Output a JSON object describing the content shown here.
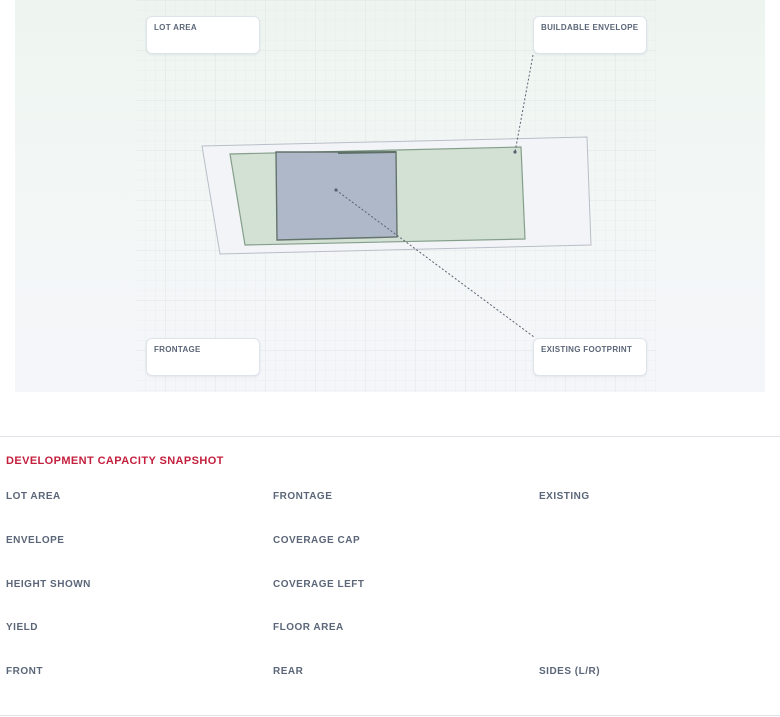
{
  "diagram": {
    "callouts": {
      "lot_area": "LOT AREA",
      "buildable_envelope": "BUILDABLE ENVELOPE",
      "frontage": "FRONTAGE",
      "existing_footprint": "EXISTING FOOTPRINT"
    },
    "colors": {
      "lot_fill": "#f2f4f8",
      "lot_stroke": "#b9bec8",
      "envelope_fill": "#d2e0d4",
      "envelope_stroke": "#7f9a84",
      "footprint_fill": "#aeb6c9",
      "footprint_stroke": "#5e6f68",
      "leader_line": "#5a6272",
      "grid": "#dfe8e4"
    }
  },
  "snapshot": {
    "title": "DEVELOPMENT CAPACITY SNAPSHOT",
    "title_color": "#c4203e",
    "rows": [
      [
        "LOT AREA",
        "FRONTAGE",
        "EXISTING"
      ],
      [
        "ENVELOPE",
        "COVERAGE CAP",
        ""
      ],
      [
        "HEIGHT SHOWN",
        "COVERAGE LEFT",
        ""
      ],
      [
        "YIELD",
        "FLOOR AREA",
        ""
      ],
      [
        "FRONT",
        "REAR",
        "SIDES (L/R)"
      ]
    ]
  }
}
